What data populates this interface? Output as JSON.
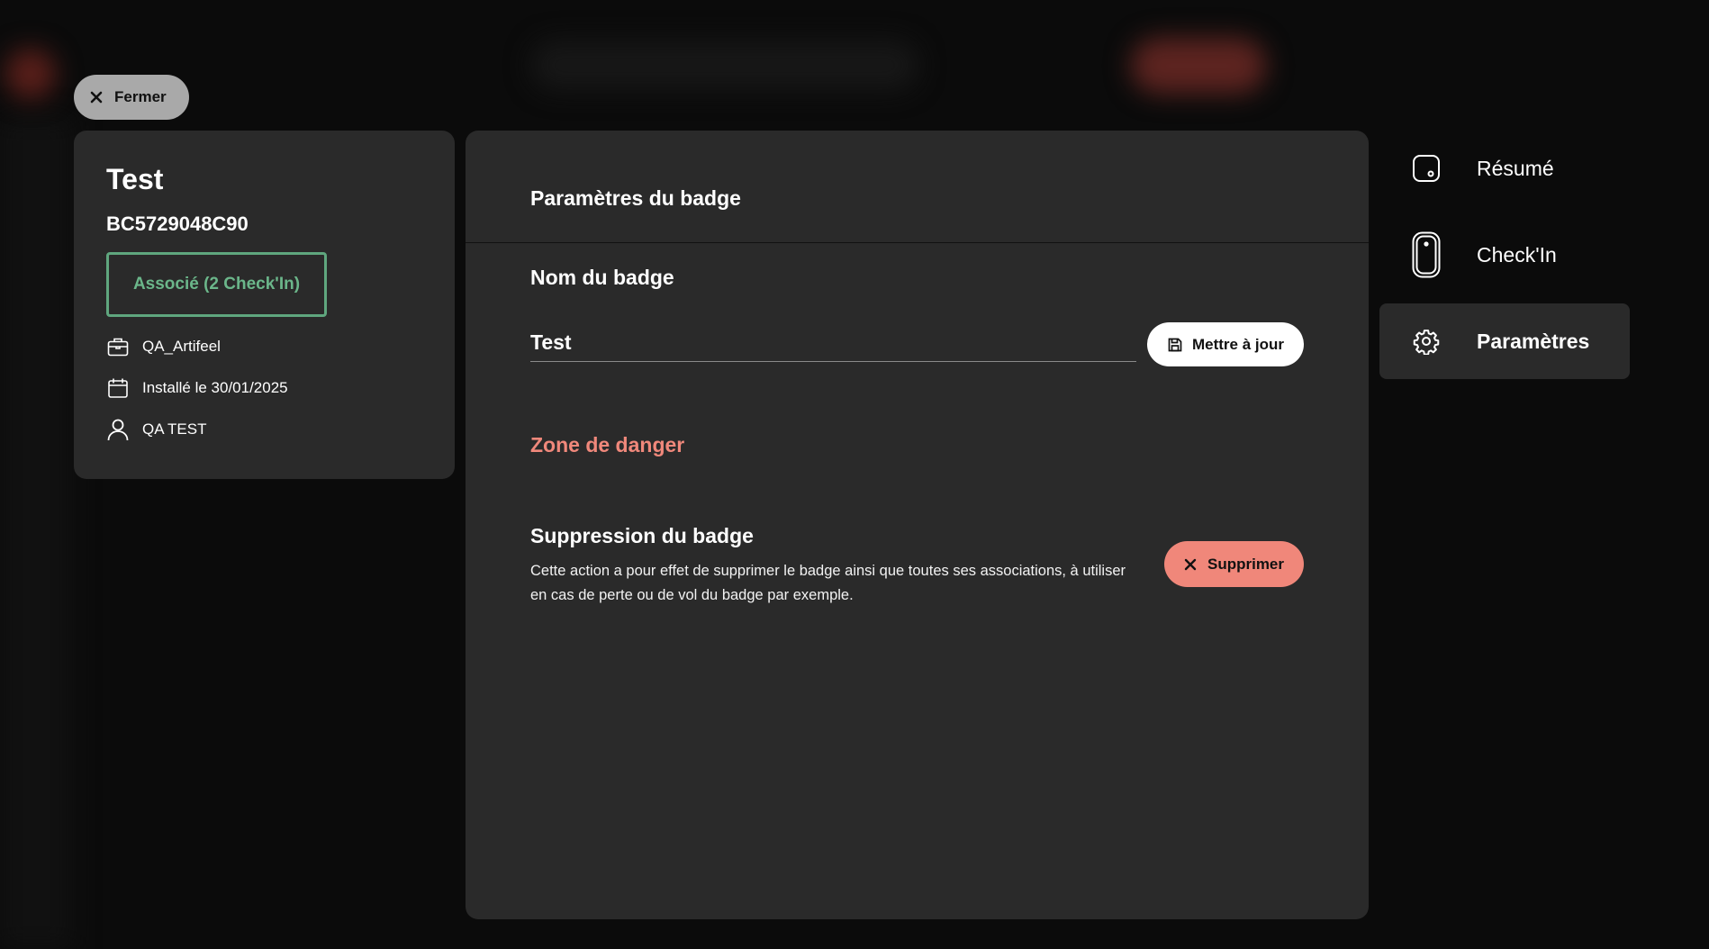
{
  "close_label": "Fermer",
  "badge": {
    "title": "Test",
    "code": "BC5729048C90",
    "status": "Associé (2 Check'In)",
    "company": "QA_Artifeel",
    "installed": "Installé le 30/01/2025",
    "user": "QA TEST"
  },
  "panel": {
    "title": "Paramètres du badge",
    "name_label": "Nom du badge",
    "name_value": "Test",
    "update_label": "Mettre à jour",
    "danger_title": "Zone de danger",
    "delete_title": "Suppression du badge",
    "delete_desc": "Cette action a pour effet de supprimer le badge ainsi que toutes ses associations, à utiliser en cas de perte ou de vol du badge par exemple.",
    "delete_label": "Supprimer"
  },
  "nav": {
    "summary": "Résumé",
    "checkin": "Check'In",
    "settings": "Paramètres"
  },
  "colors": {
    "status_green": "#5fa67e",
    "danger": "#f0877a",
    "panel_bg": "#2a2a2a"
  }
}
